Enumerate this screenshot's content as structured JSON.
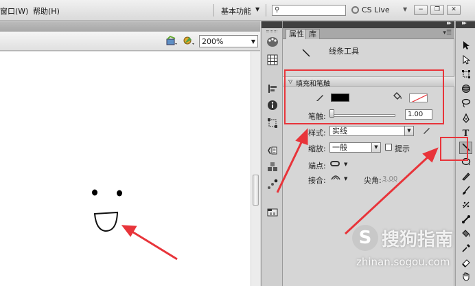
{
  "menubar": {
    "items": [
      "窗口(W)",
      "帮助(H)"
    ],
    "workspace": "基本功能",
    "search_placeholder": "",
    "cs_live": "CS Live",
    "win_minimize": "−",
    "win_restore": "❐",
    "win_close": "✕"
  },
  "editbar": {
    "zoom": "200%"
  },
  "panel": {
    "tabs": [
      "属性",
      "库"
    ],
    "tool_name": "线条工具",
    "section_title": "填充和笔触",
    "stroke_label": "笔触:",
    "stroke_value": "1.00",
    "style_label": "样式:",
    "style_value": "实线",
    "scale_label": "缩放:",
    "scale_value": "一般",
    "hint_label": "提示",
    "cap_label": "端点:",
    "join_label": "接合:",
    "miter_label": "尖角:",
    "miter_value": "3.00"
  },
  "icons": {
    "dock": [
      "color-palette-icon",
      "swatches-icon",
      "align-icon",
      "info-icon",
      "transform-icon",
      "code-snippets-icon",
      "components-icon",
      "motion-presets-icon",
      "project-icon"
    ],
    "tools": [
      "selection-tool-icon",
      "subselection-tool-icon",
      "free-transform-icon",
      "3d-rotation-icon",
      "lasso-icon",
      "pen-icon",
      "text-icon",
      "line-tool-icon",
      "oval-icon",
      "pencil-icon",
      "brush-icon",
      "deco-icon",
      "bone-icon",
      "paint-bucket-icon",
      "eyedropper-icon",
      "eraser-icon",
      "hand-icon"
    ]
  },
  "colors": {
    "annotation": "#e8343a",
    "stroke": "#000000",
    "fill": "#ffffff"
  },
  "watermark": {
    "logo": "S",
    "brand": "搜狗指南",
    "url": "zhinan.sogou.com"
  }
}
